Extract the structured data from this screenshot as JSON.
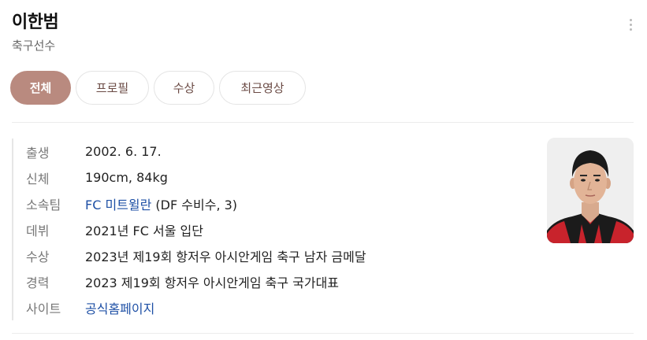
{
  "header": {
    "name": "이한범",
    "subtitle": "축구선수"
  },
  "tabs": [
    {
      "label": "전체",
      "active": true
    },
    {
      "label": "프로필",
      "active": false
    },
    {
      "label": "수상",
      "active": false
    },
    {
      "label": "최근영상",
      "active": false
    }
  ],
  "info": {
    "birth": {
      "label": "출생",
      "value": "2002. 6. 17."
    },
    "body": {
      "label": "신체",
      "value": "190cm, 84kg"
    },
    "team": {
      "label": "소속팀",
      "link": "FC 미트윌란",
      "detail": " (DF 수비수, 3)"
    },
    "debut": {
      "label": "데뷔",
      "value": "2021년 FC 서울 입단"
    },
    "award": {
      "label": "수상",
      "value": "2023년 제19회 항저우 아시안게임 축구 남자 금메달"
    },
    "career": {
      "label": "경력",
      "value": "2023 제19회 항저우 아시안게임 축구 국가대표"
    },
    "site": {
      "label": "사이트",
      "link": "공식홈페이지"
    }
  },
  "colors": {
    "tab_active_bg": "#b98a7f",
    "tab_text": "#6b4b45",
    "link": "#1d4fa5",
    "jersey_red": "#c8232c",
    "jersey_black": "#1b1b1b"
  },
  "icons": {
    "more": "vertical-ellipsis-icon"
  }
}
